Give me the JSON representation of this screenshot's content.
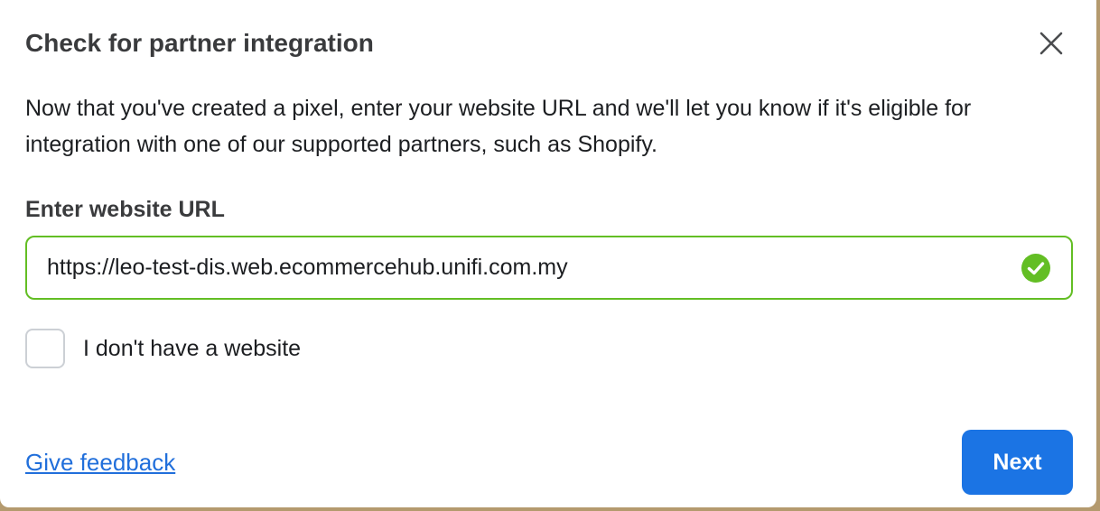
{
  "dialog": {
    "title": "Check for partner integration",
    "close_icon": "close-icon",
    "description": "Now that you've created a pixel, enter your website URL and we'll let you know if it's eligible for integration with one of our supported partners, such as Shopify.",
    "url_label": "Enter website URL",
    "url_value": "https://leo-test-dis.web.ecommercehub.unifi.com.my",
    "url_valid_icon": "checkmark-circle-icon",
    "no_website_label": "I don't have a website",
    "no_website_checked": false,
    "feedback_link": "Give feedback",
    "next_label": "Next"
  },
  "colors": {
    "accent": "#1b74e4",
    "valid": "#63be24",
    "link": "#216fdb"
  }
}
